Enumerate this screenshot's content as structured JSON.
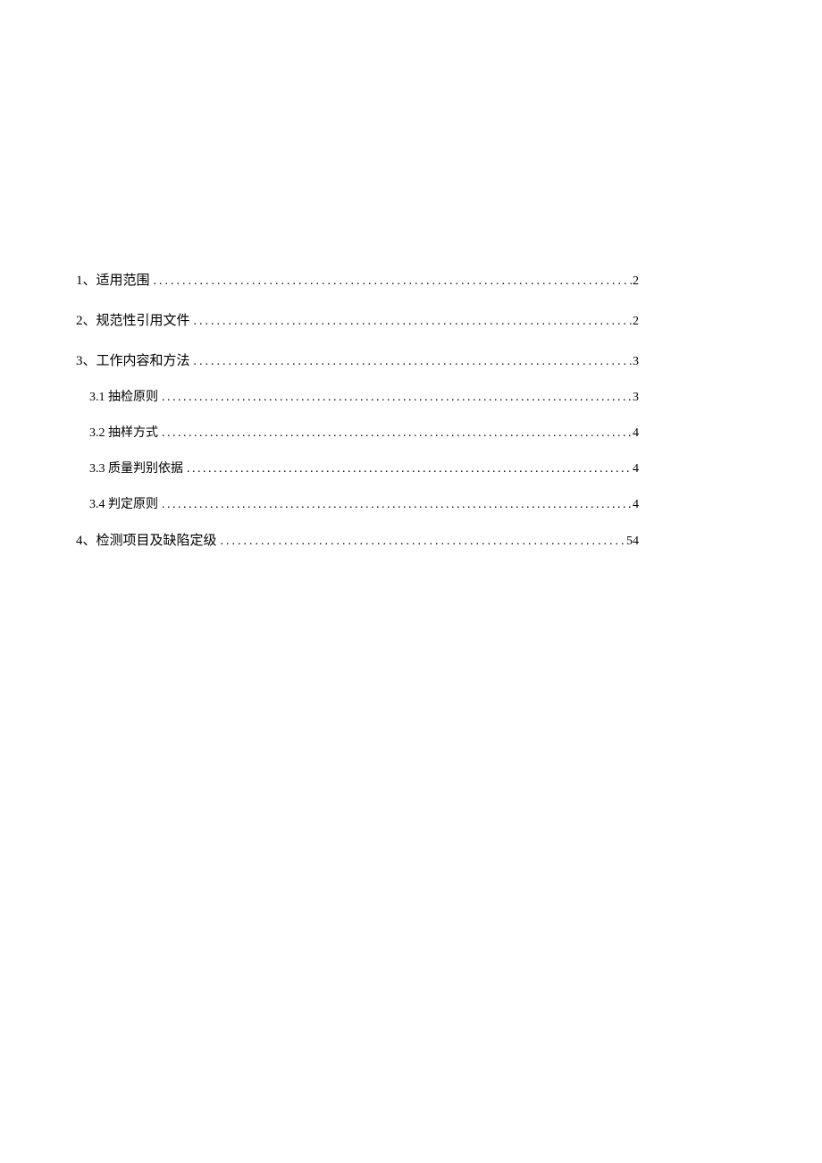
{
  "toc": {
    "entries": [
      {
        "label": "1、适用范围",
        "page": "2",
        "level": 1
      },
      {
        "label": "2、规范性引用文件",
        "page": "2",
        "level": 1
      },
      {
        "label": "3、工作内容和方法",
        "page": "3",
        "level": 1
      },
      {
        "label": "3.1 抽检原则",
        "page": "3",
        "level": 2
      },
      {
        "label": "3.2 抽样方式",
        "page": "4",
        "level": 2
      },
      {
        "label": "3.3 质量判别依据",
        "page": "4",
        "level": 2
      },
      {
        "label": "3.4 判定原则",
        "page": "4",
        "level": 2
      },
      {
        "label": "4、检测项目及缺陷定级",
        "page": "54",
        "level": 1
      }
    ]
  }
}
